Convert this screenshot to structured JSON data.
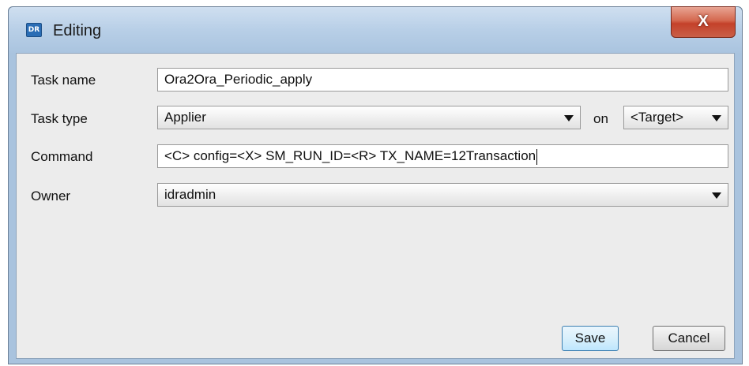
{
  "window": {
    "title": "Editing",
    "app_icon_text": "DR",
    "close_label": "X"
  },
  "form": {
    "task_name": {
      "label": "Task name",
      "value": "Ora2Ora_Periodic_apply"
    },
    "task_type": {
      "label": "Task type",
      "value": "Applier",
      "on_label": "on",
      "target_value": "<Target>"
    },
    "command": {
      "label": "Command",
      "value": "<C> config=<X> SM_RUN_ID=<R> TX_NAME=12Transaction"
    },
    "owner": {
      "label": "Owner",
      "value": "idradmin"
    }
  },
  "buttons": {
    "save_label": "Save",
    "cancel_label": "Cancel"
  }
}
